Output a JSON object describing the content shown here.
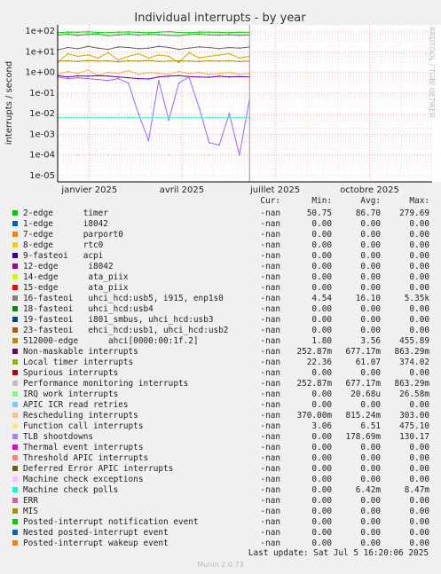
{
  "chart_data": {
    "type": "line",
    "title": "Individual interrupts - by year",
    "ylabel": "interrupts / second",
    "side_label": "RRDTOOL / TOBI OETIKER",
    "y_scale": "log",
    "ylim": [
      5e-06,
      200
    ],
    "y_ticks": [
      "1e+02",
      "1e+01",
      "1e+00",
      "1e-01",
      "1e-02",
      "1e-03",
      "1e-04",
      "1e-05"
    ],
    "y_tick_values": [
      100,
      10,
      1,
      0.1,
      0.01,
      0.001,
      0.0001,
      1e-05
    ],
    "x_ticks": [
      "janvier 2025",
      "avril 2025",
      "juillet 2025",
      "octobre 2025"
    ],
    "x_tick_days": [
      31,
      121,
      212,
      304
    ],
    "x_range_days": [
      0,
      365
    ],
    "now_day": 187,
    "grid": true,
    "series": [
      {
        "name": "Local timer interrupts",
        "color": "#00aa00",
        "values": [
          65,
          70,
          62,
          68,
          72,
          60,
          66,
          70,
          64,
          69,
          67,
          63,
          61,
          68,
          70,
          66,
          64,
          67,
          62,
          65
        ]
      },
      {
        "name": "2-edge      timer",
        "color": "#00cc00",
        "values": [
          85,
          90,
          88,
          92,
          86,
          84,
          89,
          91,
          87,
          85,
          88,
          93,
          86,
          84,
          90,
          89,
          87,
          85,
          88,
          86
        ]
      },
      {
        "name": "Function call interrupts",
        "color": "#ccaa00",
        "values": [
          3,
          8,
          6,
          7,
          5,
          9,
          4,
          6,
          8,
          5,
          7,
          6,
          3,
          9,
          5,
          6,
          7,
          8,
          5,
          6
        ]
      },
      {
        "name": "16-fasteoi   uhci_hcd:usb5, i915, enp1s0",
        "color": "#606060",
        "values": [
          12,
          16,
          14,
          18,
          15,
          13,
          17,
          16,
          14,
          15,
          18,
          16,
          13,
          15,
          17,
          16,
          14,
          16,
          15,
          17
        ]
      },
      {
        "name": "512000-edge      ahci[0000:00:1f.2]",
        "color": "#aa8800",
        "values": [
          3.5,
          3.6,
          3.4,
          3.7,
          3.5,
          3.6,
          3.3,
          3.6,
          3.5,
          3.7,
          3.4,
          3.5,
          3.6,
          3.5,
          3.4,
          3.6,
          3.5,
          3.6,
          3.4,
          3.5
        ]
      },
      {
        "name": "Rescheduling interrupts",
        "color": "#ffaa55",
        "values": [
          0.8,
          1.1,
          0.9,
          1.3,
          0.7,
          1.0,
          0.9,
          1.2,
          0.8,
          1.0,
          0.9,
          0.8,
          1.1,
          0.9,
          1.0,
          0.8,
          0.9,
          1.0,
          0.8,
          0.9
        ]
      },
      {
        "name": "Non-maskable interrupts",
        "color": "#660099",
        "values": [
          0.7,
          0.6,
          0.68,
          0.65,
          0.7,
          0.66,
          0.6,
          0.55,
          0.5,
          0.48,
          0.6,
          0.65,
          0.7,
          0.62,
          0.6,
          0.58,
          0.65,
          0.6,
          0.62,
          0.6
        ]
      },
      {
        "name": "Performance monitoring interrupts",
        "color": "#9966ff",
        "values": [
          0.6,
          0.5,
          0.55,
          0.5,
          0.45,
          0.4,
          0.5,
          0.3,
          0.01,
          0.0005,
          0.4,
          0.005,
          0.3,
          0.6,
          0.02,
          0.0004,
          0.0003,
          0.01,
          0.0001,
          0.05
        ]
      },
      {
        "name": "Machine check polls",
        "color": "#33ffcc",
        "values": [
          0.0064,
          0.0064,
          0.0064,
          0.0064,
          0.0064,
          0.0064,
          0.0064,
          0.0064,
          0.0064,
          0.0064,
          0.0064,
          0.0064,
          0.0064,
          0.0064,
          0.0064,
          0.0064,
          0.0064,
          0.0064,
          0.0064,
          0.0064
        ]
      },
      {
        "name": "IRQ work interrupts",
        "color": "#88ee88",
        "values": [
          0.0001,
          0,
          0.0001,
          0,
          0,
          0.0001,
          0,
          0,
          0,
          0,
          0,
          0.0001,
          0,
          0,
          0,
          0.0001,
          0,
          0,
          0,
          0
        ]
      }
    ]
  },
  "legend": {
    "headers": {
      "cur": "Cur:",
      "min": "Min:",
      "avg": "Avg:",
      "max": "Max:"
    },
    "rows": [
      {
        "label": "2-edge      timer",
        "color": "#00cc00",
        "cur": "-nan",
        "min": "50.75",
        "avg": "86.70",
        "max": "279.69"
      },
      {
        "label": "1-edge      i8042",
        "color": "#0066b3",
        "cur": "-nan",
        "min": "0.00",
        "avg": "0.00",
        "max": "0.00"
      },
      {
        "label": "7-edge      parport0",
        "color": "#ff8000",
        "cur": "-nan",
        "min": "0.00",
        "avg": "0.00",
        "max": "0.00"
      },
      {
        "label": "8-edge      rtc0",
        "color": "#ffcc00",
        "cur": "-nan",
        "min": "0.00",
        "avg": "0.00",
        "max": "0.00"
      },
      {
        "label": "9-fasteoi   acpi",
        "color": "#330099",
        "cur": "-nan",
        "min": "0.00",
        "avg": "0.00",
        "max": "0.00"
      },
      {
        "label": "12-edge      i8042",
        "color": "#990099",
        "cur": "-nan",
        "min": "0.00",
        "avg": "0.00",
        "max": "0.00"
      },
      {
        "label": "14-edge      ata_piix",
        "color": "#ccff00",
        "cur": "-nan",
        "min": "0.00",
        "avg": "0.00",
        "max": "0.00"
      },
      {
        "label": "15-edge      ata_piix",
        "color": "#ff0000",
        "cur": "-nan",
        "min": "0.00",
        "avg": "0.00",
        "max": "0.00"
      },
      {
        "label": "16-fasteoi   uhci_hcd:usb5, i915, enp1s0",
        "color": "#808080",
        "cur": "-nan",
        "min": "4.54",
        "avg": "16.10",
        "max": "5.35k"
      },
      {
        "label": "18-fasteoi   uhci_hcd:usb4",
        "color": "#008f00",
        "cur": "-nan",
        "min": "0.00",
        "avg": "0.00",
        "max": "0.00"
      },
      {
        "label": "19-fasteoi   i801_smbus, uhci_hcd:usb3",
        "color": "#00487d",
        "cur": "-nan",
        "min": "0.00",
        "avg": "0.00",
        "max": "0.00"
      },
      {
        "label": "23-fasteoi   ehci_hcd:usb1, uhci_hcd:usb2",
        "color": "#b35a00",
        "cur": "-nan",
        "min": "0.00",
        "avg": "0.00",
        "max": "0.00"
      },
      {
        "label": "512000-edge      ahci[0000:00:1f.2]",
        "color": "#b38f00",
        "cur": "-nan",
        "min": "1.80",
        "avg": "3.56",
        "max": "455.89"
      },
      {
        "label": "Non-maskable interrupts",
        "color": "#6b006b",
        "cur": "-nan",
        "min": "252.87m",
        "avg": "677.17m",
        "max": "863.29m"
      },
      {
        "label": "Local timer interrupts",
        "color": "#8fb300",
        "cur": "-nan",
        "min": "22.36",
        "avg": "61.07",
        "max": "374.02"
      },
      {
        "label": "Spurious interrupts",
        "color": "#b30000",
        "cur": "-nan",
        "min": "0.00",
        "avg": "0.00",
        "max": "0.00"
      },
      {
        "label": "Performance monitoring interrupts",
        "color": "#bebebe",
        "cur": "-nan",
        "min": "252.87m",
        "avg": "677.17m",
        "max": "863.29m"
      },
      {
        "label": "IRQ work interrupts",
        "color": "#80ff80",
        "cur": "-nan",
        "min": "0.00",
        "avg": "20.68u",
        "max": "26.58m"
      },
      {
        "label": "APIC ICR read retries",
        "color": "#80c9ff",
        "cur": "-nan",
        "min": "0.00",
        "avg": "0.00",
        "max": "0.00"
      },
      {
        "label": "Rescheduling interrupts",
        "color": "#ffc080",
        "cur": "-nan",
        "min": "370.00m",
        "avg": "815.24m",
        "max": "303.00"
      },
      {
        "label": "Function call interrupts",
        "color": "#ffe680",
        "cur": "-nan",
        "min": "3.06",
        "avg": "6.51",
        "max": "475.10"
      },
      {
        "label": "TLB shootdowns",
        "color": "#aa80ff",
        "cur": "-nan",
        "min": "0.00",
        "avg": "178.69m",
        "max": "130.17"
      },
      {
        "label": "Thermal event interrupts",
        "color": "#ee00cc",
        "cur": "-nan",
        "min": "0.00",
        "avg": "0.00",
        "max": "0.00"
      },
      {
        "label": "Threshold APIC interrupts",
        "color": "#ff8080",
        "cur": "-nan",
        "min": "0.00",
        "avg": "0.00",
        "max": "0.00"
      },
      {
        "label": "Deferred Error APIC interrupts",
        "color": "#666600",
        "cur": "-nan",
        "min": "0.00",
        "avg": "0.00",
        "max": "0.00"
      },
      {
        "label": "Machine check exceptions",
        "color": "#ffbfff",
        "cur": "-nan",
        "min": "0.00",
        "avg": "0.00",
        "max": "0.00"
      },
      {
        "label": "Machine check polls",
        "color": "#00ffcc",
        "cur": "-nan",
        "min": "0.00",
        "avg": "6.42m",
        "max": "8.47m"
      },
      {
        "label": "ERR",
        "color": "#cc6699",
        "cur": "-nan",
        "min": "0.00",
        "avg": "0.00",
        "max": "0.00"
      },
      {
        "label": "MIS",
        "color": "#999900",
        "cur": "-nan",
        "min": "0.00",
        "avg": "0.00",
        "max": "0.00"
      },
      {
        "label": "Posted-interrupt notification event",
        "color": "#00cc00",
        "cur": "-nan",
        "min": "0.00",
        "avg": "0.00",
        "max": "0.00"
      },
      {
        "label": "Nested posted-interrupt event",
        "color": "#0066b3",
        "cur": "-nan",
        "min": "0.00",
        "avg": "0.00",
        "max": "0.00"
      },
      {
        "label": "Posted-interrupt wakeup event",
        "color": "#ff8000",
        "cur": "-nan",
        "min": "0.00",
        "avg": "0.00",
        "max": "0.00"
      }
    ]
  },
  "footer": {
    "last_update": "Last update: Sat Jul  5 16:20:06 2025",
    "generator": "Munin 2.0.73"
  }
}
